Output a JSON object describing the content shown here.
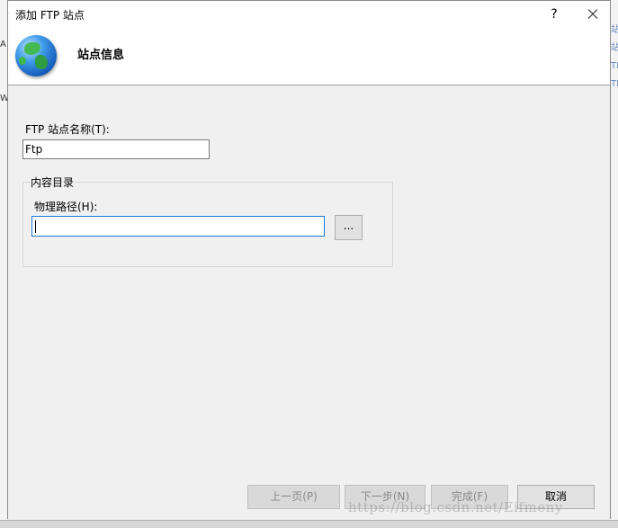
{
  "window": {
    "title": "添加 FTP 站点",
    "help_label": "?",
    "close_label": "✕"
  },
  "background": {
    "left_fragments": [
      "A",
      "W"
    ],
    "right_fragments": [
      "站",
      "站",
      "TP",
      "TP"
    ]
  },
  "header": {
    "icon": "globe-icon",
    "title": "站点信息"
  },
  "site_name": {
    "label": "FTP 站点名称(T):",
    "value": "Ftp"
  },
  "content_directory": {
    "group_title": "内容目录",
    "physical_path_label": "物理路径(H):",
    "physical_path_value": "",
    "browse_label": "..."
  },
  "footer": {
    "prev_label": "上一页(P)",
    "next_label": "下一步(N)",
    "finish_label": "完成(F)",
    "cancel_label": "取消"
  },
  "watermark": "https://blog.csdn.net/Eifmeny"
}
